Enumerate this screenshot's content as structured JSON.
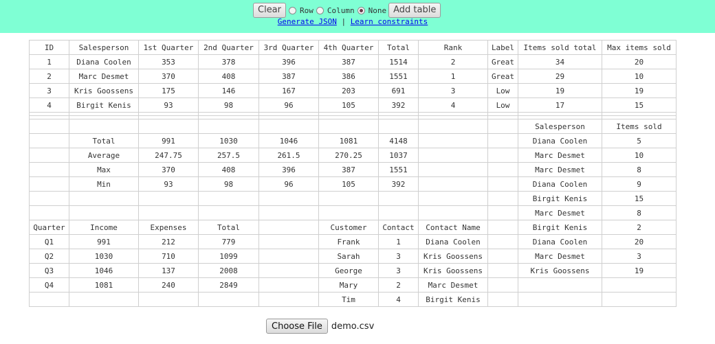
{
  "toolbar": {
    "clear_label": "Clear",
    "add_table_label": "Add table",
    "radios": [
      {
        "label": "Row",
        "checked": false
      },
      {
        "label": "Column",
        "checked": false
      },
      {
        "label": "None",
        "checked": true
      }
    ],
    "generate_json_label": "Generate JSON",
    "separator": "|",
    "learn_constraints_label": "Learn constraints"
  },
  "grid": {
    "rows": [
      [
        "ID",
        "Salesperson",
        "1st Quarter",
        "2nd Quarter",
        "3rd Quarter",
        "4th Quarter",
        "Total",
        "Rank",
        "Label",
        "Items sold total",
        "Max items sold"
      ],
      [
        "1",
        "Diana Coolen",
        "353",
        "378",
        "396",
        "387",
        "1514",
        "2",
        "Great",
        "34",
        "20"
      ],
      [
        "2",
        "Marc Desmet",
        "370",
        "408",
        "387",
        "386",
        "1551",
        "1",
        "Great",
        "29",
        "10"
      ],
      [
        "3",
        "Kris Goossens",
        "175",
        "146",
        "167",
        "203",
        "691",
        "3",
        "Low",
        "19",
        "19"
      ],
      [
        "4",
        "Birgit Kenis",
        "93",
        "98",
        "96",
        "105",
        "392",
        "4",
        "Low",
        "17",
        "15"
      ],
      [
        "",
        "",
        "",
        "",
        "",
        "",
        "",
        "",
        "",
        "",
        ""
      ],
      [
        "",
        "",
        "",
        "",
        "",
        "",
        "",
        "",
        "",
        "",
        ""
      ],
      [
        "",
        "",
        "",
        "",
        "",
        "",
        "",
        "",
        "",
        "Salesperson",
        "Items sold"
      ],
      [
        "",
        "Total",
        "991",
        "1030",
        "1046",
        "1081",
        "4148",
        "",
        "",
        "Diana Coolen",
        "5"
      ],
      [
        "",
        "Average",
        "247.75",
        "257.5",
        "261.5",
        "270.25",
        "1037",
        "",
        "",
        "Marc Desmet",
        "10"
      ],
      [
        "",
        "Max",
        "370",
        "408",
        "396",
        "387",
        "1551",
        "",
        "",
        "Marc Desmet",
        "8"
      ],
      [
        "",
        "Min",
        "93",
        "98",
        "96",
        "105",
        "392",
        "",
        "",
        "Diana Coolen",
        "9"
      ],
      [
        "",
        "",
        "",
        "",
        "",
        "",
        "",
        "",
        "",
        "Birgit Kenis",
        "15"
      ],
      [
        "",
        "",
        "",
        "",
        "",
        "",
        "",
        "",
        "",
        "Marc Desmet",
        "8"
      ],
      [
        "Quarter",
        "Income",
        "Expenses",
        "Total",
        "",
        "Customer",
        "Contact",
        "Contact Name",
        "",
        "Birgit Kenis",
        "2"
      ],
      [
        "Q1",
        "991",
        "212",
        "779",
        "",
        "Frank",
        "1",
        "Diana Coolen",
        "",
        "Diana Coolen",
        "20"
      ],
      [
        "Q2",
        "1030",
        "710",
        "1099",
        "",
        "Sarah",
        "3",
        "Kris Goossens",
        "",
        "Marc Desmet",
        "3"
      ],
      [
        "Q3",
        "1046",
        "137",
        "2008",
        "",
        "George",
        "3",
        "Kris Goossens",
        "",
        "Kris Goossens",
        "19"
      ],
      [
        "Q4",
        "1081",
        "240",
        "2849",
        "",
        "Mary",
        "2",
        "Marc Desmet",
        "",
        "",
        ""
      ],
      [
        "",
        "",
        "",
        "",
        "",
        "Tim",
        "4",
        "Birgit Kenis",
        "",
        "",
        ""
      ]
    ]
  },
  "file": {
    "button_label": "Choose File",
    "file_name": "demo.csv"
  }
}
